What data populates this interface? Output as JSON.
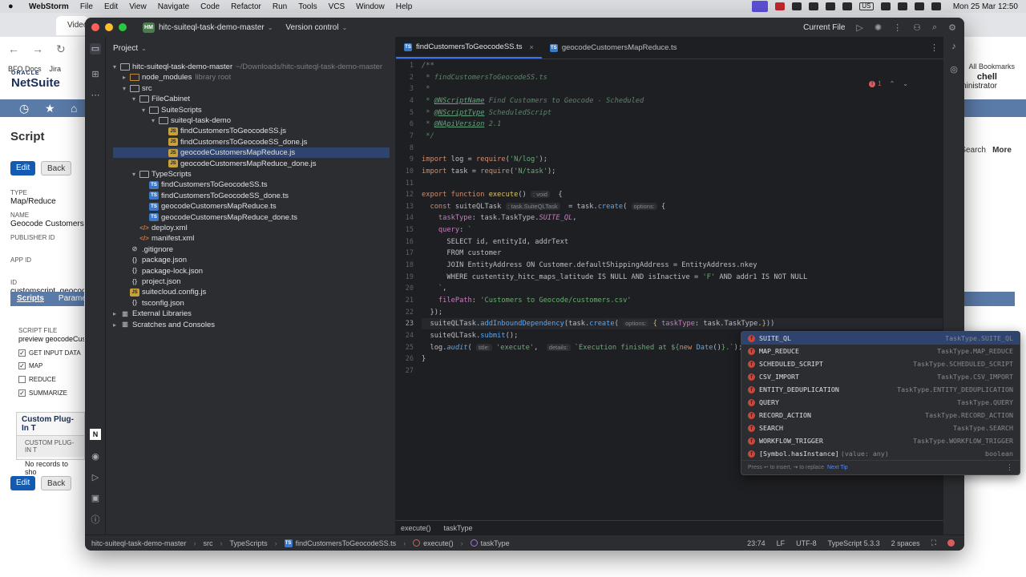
{
  "menubar": {
    "app_name": "WebStorm",
    "items": [
      "File",
      "Edit",
      "View",
      "Navigate",
      "Code",
      "Refactor",
      "Run",
      "Tools",
      "VCS",
      "Window",
      "Help"
    ],
    "status_lang": "US",
    "clock": "Mon 25 Mar  12:50"
  },
  "browser": {
    "tab_title": "Video",
    "bookmarks": [
      "BFO Docs",
      "Jira"
    ],
    "all_bookmarks": "All Bookmarks",
    "logo_top": "ORACLE",
    "logo_main": "NetSuite",
    "user_name": "chell",
    "user_role": "- Administrator",
    "page_title": "Script",
    "edit_label": "Edit",
    "back_label": "Back",
    "search_label": "Search",
    "more_label": "More",
    "fields": {
      "type_label": "TYPE",
      "type_value": "Map/Reduce",
      "name_label": "NAME",
      "name_value": "Geocode Customers - M",
      "publisher_label": "PUBLISHER ID",
      "app_label": "APP ID",
      "id_label": "ID",
      "id_value": "customscript_geocode_"
    },
    "subtabs": [
      "Scripts",
      "Parame"
    ],
    "script_file_label": "SCRIPT FILE",
    "script_file_value": "preview geocodeCus",
    "checks": [
      {
        "label": "GET INPUT DATA",
        "checked": true
      },
      {
        "label": "MAP",
        "checked": true
      },
      {
        "label": "REDUCE",
        "checked": false
      },
      {
        "label": "SUMMARIZE",
        "checked": true
      }
    ],
    "plugin_header": "Custom Plug-In T",
    "plugin_column": "CUSTOM PLUG-IN T",
    "plugin_empty": "No records to sho"
  },
  "ide": {
    "project_badge": "HM",
    "project_name": "hitc-suiteql-task-demo-master",
    "version_control": "Version control",
    "run_config": "Current File",
    "project_panel_title": "Project",
    "tree": [
      {
        "depth": 0,
        "arrow": "▾",
        "icon": "folder",
        "label": "hitc-suiteql-task-demo-master",
        "muted": "~/Downloads/hitc-suiteql-task-demo-master"
      },
      {
        "depth": 1,
        "arrow": "▸",
        "icon": "folder orange",
        "label": "node_modules",
        "muted": "library root"
      },
      {
        "depth": 1,
        "arrow": "▾",
        "icon": "folder",
        "label": "src",
        "muted": ""
      },
      {
        "depth": 2,
        "arrow": "▾",
        "icon": "folder",
        "label": "FileCabinet",
        "muted": ""
      },
      {
        "depth": 3,
        "arrow": "▾",
        "icon": "folder",
        "label": "SuiteScripts",
        "muted": ""
      },
      {
        "depth": 4,
        "arrow": "▾",
        "icon": "folder",
        "label": "suiteql-task-demo",
        "muted": ""
      },
      {
        "depth": 5,
        "arrow": "",
        "icon": "js",
        "label": "findCustomersToGeocodeSS.js",
        "muted": ""
      },
      {
        "depth": 5,
        "arrow": "",
        "icon": "js",
        "label": "findCustomersToGeocodeSS_done.js",
        "muted": ""
      },
      {
        "depth": 5,
        "arrow": "",
        "icon": "js",
        "label": "geocodeCustomersMapReduce.js",
        "muted": "",
        "selected": true
      },
      {
        "depth": 5,
        "arrow": "",
        "icon": "js",
        "label": "geocodeCustomersMapReduce_done.js",
        "muted": ""
      },
      {
        "depth": 2,
        "arrow": "▾",
        "icon": "folder",
        "label": "TypeScripts",
        "muted": ""
      },
      {
        "depth": 3,
        "arrow": "",
        "icon": "ts",
        "label": "findCustomersToGeocodeSS.ts",
        "muted": ""
      },
      {
        "depth": 3,
        "arrow": "",
        "icon": "ts",
        "label": "findCustomersToGeocodeSS_done.ts",
        "muted": ""
      },
      {
        "depth": 3,
        "arrow": "",
        "icon": "ts",
        "label": "geocodeCustomersMapReduce.ts",
        "muted": ""
      },
      {
        "depth": 3,
        "arrow": "",
        "icon": "ts",
        "label": "geocodeCustomersMapReduce_done.ts",
        "muted": ""
      },
      {
        "depth": 2,
        "arrow": "",
        "icon": "xml",
        "label": "deploy.xml",
        "muted": ""
      },
      {
        "depth": 2,
        "arrow": "",
        "icon": "xml",
        "label": "manifest.xml",
        "muted": ""
      },
      {
        "depth": 1,
        "arrow": "",
        "icon": "gi",
        "label": ".gitignore",
        "muted": ""
      },
      {
        "depth": 1,
        "arrow": "",
        "icon": "json",
        "label": "package.json",
        "muted": ""
      },
      {
        "depth": 1,
        "arrow": "",
        "icon": "json",
        "label": "package-lock.json",
        "muted": ""
      },
      {
        "depth": 1,
        "arrow": "",
        "icon": "json",
        "label": "project.json",
        "muted": ""
      },
      {
        "depth": 1,
        "arrow": "",
        "icon": "js",
        "label": "suitecloud.config.js",
        "muted": ""
      },
      {
        "depth": 1,
        "arrow": "",
        "icon": "json",
        "label": "tsconfig.json",
        "muted": ""
      },
      {
        "depth": 0,
        "arrow": "▸",
        "icon": "lib",
        "label": "External Libraries",
        "muted": ""
      },
      {
        "depth": 0,
        "arrow": "▸",
        "icon": "lib",
        "label": "Scratches and Consoles",
        "muted": ""
      }
    ],
    "tabs": [
      {
        "label": "findCustomersToGeocodeSS.ts",
        "active": true
      },
      {
        "label": "geocodeCustomersMapReduce.ts",
        "active": false
      }
    ],
    "error_count": "1",
    "current_line": 23,
    "code_lines": [
      "<span class=\"c-com\">/**</span>",
      "<span class=\"c-doc\"> * findCustomersToGeocodeSS.ts</span>",
      "<span class=\"c-doc\"> *</span>",
      "<span class=\"c-doc\"> * <span class=\"c-tag\">@NScriptName</span> Find Customers to Geocode - Scheduled</span>",
      "<span class=\"c-doc\"> * <span class=\"c-tag\">@NScriptType</span> ScheduledScript</span>",
      "<span class=\"c-doc\"> * <span class=\"c-tag\">@NApiVersion</span> 2.1</span>",
      "<span class=\"c-doc\"> */</span>",
      "",
      "<span class=\"c-kw\">import</span> log = <span class=\"c-kw\">require</span>(<span class=\"c-str\">'N/log'</span>);",
      "<span class=\"c-kw\">import</span> task = <span class=\"c-kw\">require</span>(<span class=\"c-str\">'N/task'</span>);",
      "",
      "<span class=\"c-kw\">export function</span> <span class=\"c-fnd\">execute</span>() <span class=\"c-hint\">: void</span>  {",
      "  <span class=\"c-kw\">const</span> suiteQLTask <span class=\"c-hint\">: task.SuiteQLTask</span>  = task.<span class=\"c-fn\">create</span>( <span class=\"c-hint\">options:</span> {",
      "    <span class=\"c-prop\">taskType</span>: task.TaskType.<span class=\"c-const\">SUITE_QL</span>,",
      "    <span class=\"c-prop\">query</span>: <span class=\"c-tpl\">`</span>",
      "      <span class=\"c-sql\">SELECT id, entityId, addrText</span>",
      "      <span class=\"c-sql\">FROM customer</span>",
      "      <span class=\"c-sql\">JOIN EntityAddress ON Customer.defaultShippingAddress = EntityAddress.nkey</span>",
      "      <span class=\"c-sql\">WHERE custentity_hitc_maps_latitude IS NULL AND isInactive = <span class=\"c-str\">'F'</span> AND addr1 IS NOT NULL</span>",
      "    <span class=\"c-tpl\">`</span>,",
      "    <span class=\"c-prop\">filePath</span>: <span class=\"c-str\">'Customers to Geocode/customers.csv'</span>",
      "  });",
      "  suiteQLTask.<span class=\"c-fn\">addInboundDependency</span>(task.<span class=\"c-fn\">create</span>( <span class=\"c-hint\">options:</span> <span class=\"c-brace\">{</span> <span class=\"c-prop\">taskType</span>: task.TaskType.<span class=\"c-brace\">}</span>))",
      "  suiteQLTask.<span class=\"c-fn\">submit</span>();",
      "  log.<span class=\"c-fn\" style=\"font-style:italic\">audit</span>( <span class=\"c-hint\">title:</span> <span class=\"c-str\">'execute'</span>,  <span class=\"c-hint\">details:</span> <span class=\"c-tpl\">`Execution finished at ${</span><span class=\"c-kw\">new</span> <span class=\"c-fn\">Date</span>()<span class=\"c-tpl\">}.`</span>);",
      "}",
      ""
    ],
    "completion": [
      {
        "name": "SUITE_QL",
        "extra": "",
        "type": "TaskType.SUITE_QL",
        "selected": true
      },
      {
        "name": "MAP_REDUCE",
        "extra": "",
        "type": "TaskType.MAP_REDUCE"
      },
      {
        "name": "SCHEDULED_SCRIPT",
        "extra": "",
        "type": "TaskType.SCHEDULED_SCRIPT"
      },
      {
        "name": "CSV_IMPORT",
        "extra": "",
        "type": "TaskType.CSV_IMPORT"
      },
      {
        "name": "ENTITY_DEDUPLICATION",
        "extra": "",
        "type": "TaskType.ENTITY_DEDUPLICATION"
      },
      {
        "name": "QUERY",
        "extra": "",
        "type": "TaskType.QUERY"
      },
      {
        "name": "RECORD_ACTION",
        "extra": "",
        "type": "TaskType.RECORD_ACTION"
      },
      {
        "name": "SEARCH",
        "extra": "",
        "type": "TaskType.SEARCH"
      },
      {
        "name": "WORKFLOW_TRIGGER",
        "extra": "",
        "type": "TaskType.WORKFLOW_TRIGGER"
      },
      {
        "name": "[Symbol.hasInstance]",
        "extra": "(value: any)",
        "type": "boolean"
      }
    ],
    "completion_footer": "Press ↩ to insert, ⇥ to replace",
    "completion_next_tip": "Next Tip",
    "editor_breadcrumbs": [
      "execute()",
      "taskType"
    ],
    "status": {
      "path": [
        "hitc-suiteql-task-demo-master",
        "src",
        "TypeScripts",
        "findCustomersToGeocodeSS.ts",
        "execute()",
        "taskType"
      ],
      "position": "23:74",
      "line_sep": "LF",
      "encoding": "UTF-8",
      "language": "TypeScript 5.3.3",
      "indent": "2 spaces"
    }
  }
}
